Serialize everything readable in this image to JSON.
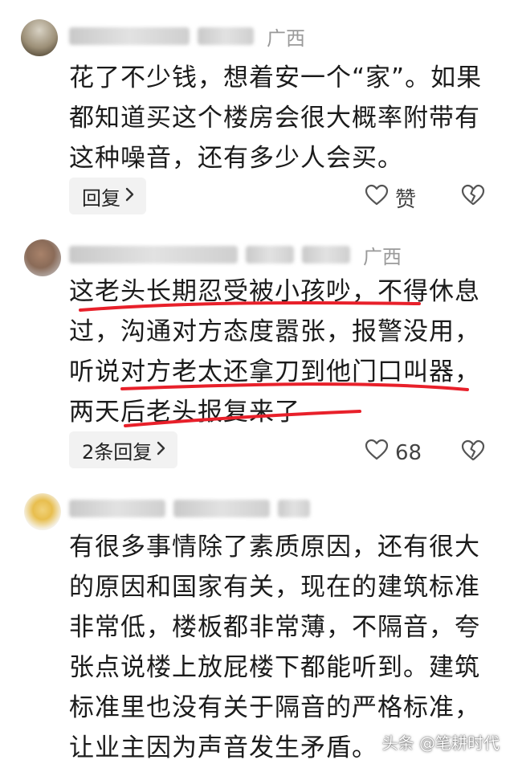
{
  "comments": [
    {
      "region": "广西",
      "lines": [
        "花了不少钱，想着安一个“家”。如果",
        "都知道买这个楼房会很大概率附带有",
        "这种噪音，还有多少人会买。"
      ],
      "reply_label": "回复",
      "like_label": "赞"
    },
    {
      "region": "广西",
      "lines": [
        "这老头长期忍受被小孩吵，不得休息",
        "过，沟通对方态度嚣张，报警没用，",
        "听说对方老太还拿刀到他门口叫器，",
        "两天后老头报复来了"
      ],
      "reply_label": "2条回复",
      "like_count": "68"
    },
    {
      "lines": [
        "有很多事情除了素质原因，还有很大",
        "的原因和国家有关，现在的建筑标准",
        "非常低，楼板都非常薄，不隔音，夸",
        "张点说楼上放屁楼下都能听到。建筑",
        "标准里也没有关于隔音的严格标准，",
        "让业主因为声音发生矛盾。"
      ]
    }
  ],
  "watermark": "头条 @笔耕时代",
  "colors": {
    "underline": "#e8202a",
    "reply_bg": "#f2f2f2",
    "region": "#9a9a9a"
  },
  "icons": [
    "heart-outline-icon",
    "broken-heart-icon",
    "chevron-right-icon"
  ]
}
